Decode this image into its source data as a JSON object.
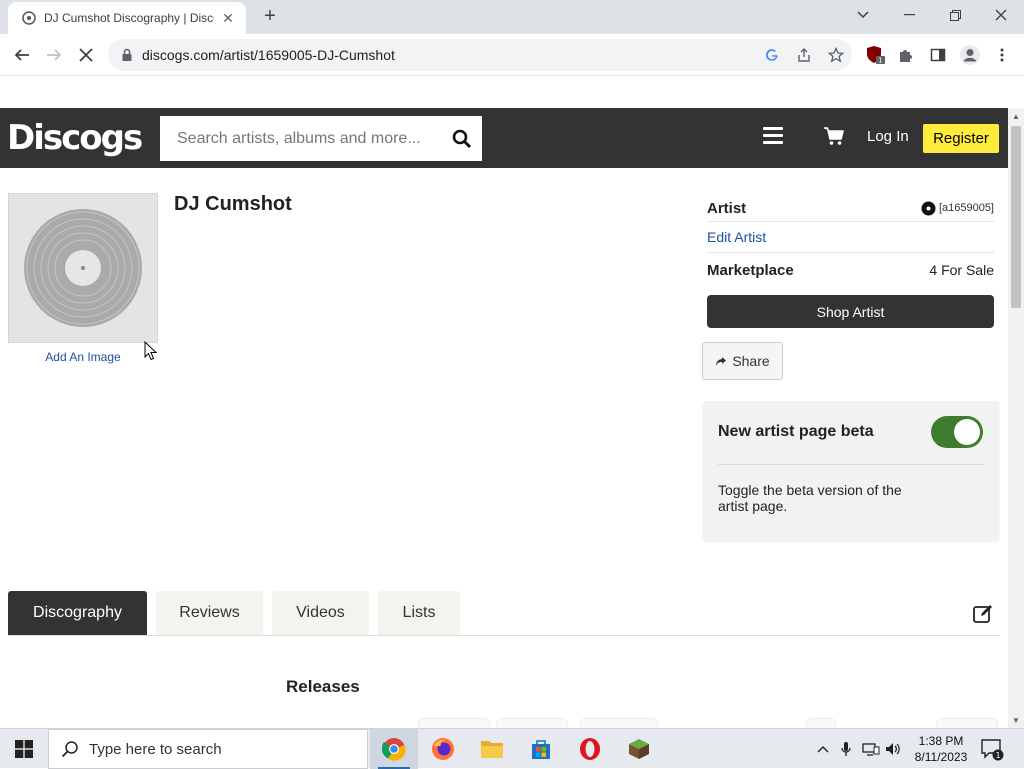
{
  "browser": {
    "tab_title": "DJ Cumshot Discography | Disco",
    "url": "discogs.com/artist/1659005-DJ-Cumshot",
    "extension_badge": "1"
  },
  "header": {
    "logo": "Discogs",
    "search_placeholder": "Search artists, albums and more...",
    "login_label": "Log In",
    "register_label": "Register"
  },
  "artist": {
    "name": "DJ Cumshot",
    "add_image_label": "Add An Image"
  },
  "sidebar": {
    "artist_label": "Artist",
    "artist_id": "[a1659005]",
    "edit_artist_label": "Edit Artist",
    "marketplace_label": "Marketplace",
    "for_sale_text": "4 For Sale",
    "shop_artist_label": "Shop Artist",
    "share_label": "Share"
  },
  "beta_panel": {
    "title": "New artist page beta",
    "description": "Toggle the beta version of the artist page.",
    "toggle_on": true
  },
  "tabs": [
    {
      "label": "Discography",
      "active": true
    },
    {
      "label": "Reviews",
      "active": false
    },
    {
      "label": "Videos",
      "active": false
    },
    {
      "label": "Lists",
      "active": false
    }
  ],
  "section": {
    "releases_title": "Releases"
  },
  "taskbar": {
    "search_placeholder": "Type here to search",
    "time": "1:38 PM",
    "date": "8/11/2023",
    "notification_count": "1"
  },
  "colors": {
    "header_bg": "#333333",
    "register_bg": "#ffeb3b",
    "toggle_on": "#3e7d2f",
    "link": "#1f4fa8"
  }
}
